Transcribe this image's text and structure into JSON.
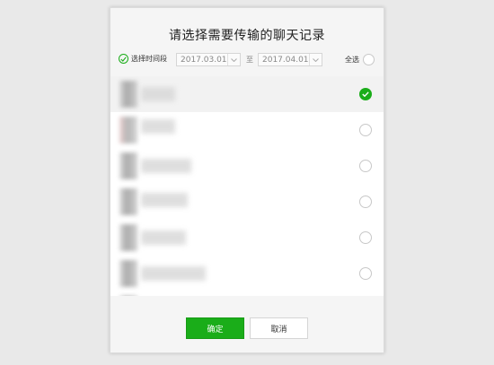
{
  "dialog": {
    "title": "请选择需要传输的聊天记录",
    "filter": {
      "period_label": "选择时间段",
      "start_date": "2017.03.01",
      "separator": "至",
      "end_date": "2017.04.01",
      "select_all_label": "全选"
    },
    "chats": [
      {
        "selected": true
      },
      {
        "selected": false
      },
      {
        "selected": false
      },
      {
        "selected": false
      },
      {
        "selected": false
      },
      {
        "selected": false
      }
    ],
    "buttons": {
      "confirm": "确定",
      "cancel": "取消"
    }
  },
  "colors": {
    "accent": "#1aad19",
    "background": "#e9e9e9",
    "dialog_bg": "#f5f5f5"
  }
}
